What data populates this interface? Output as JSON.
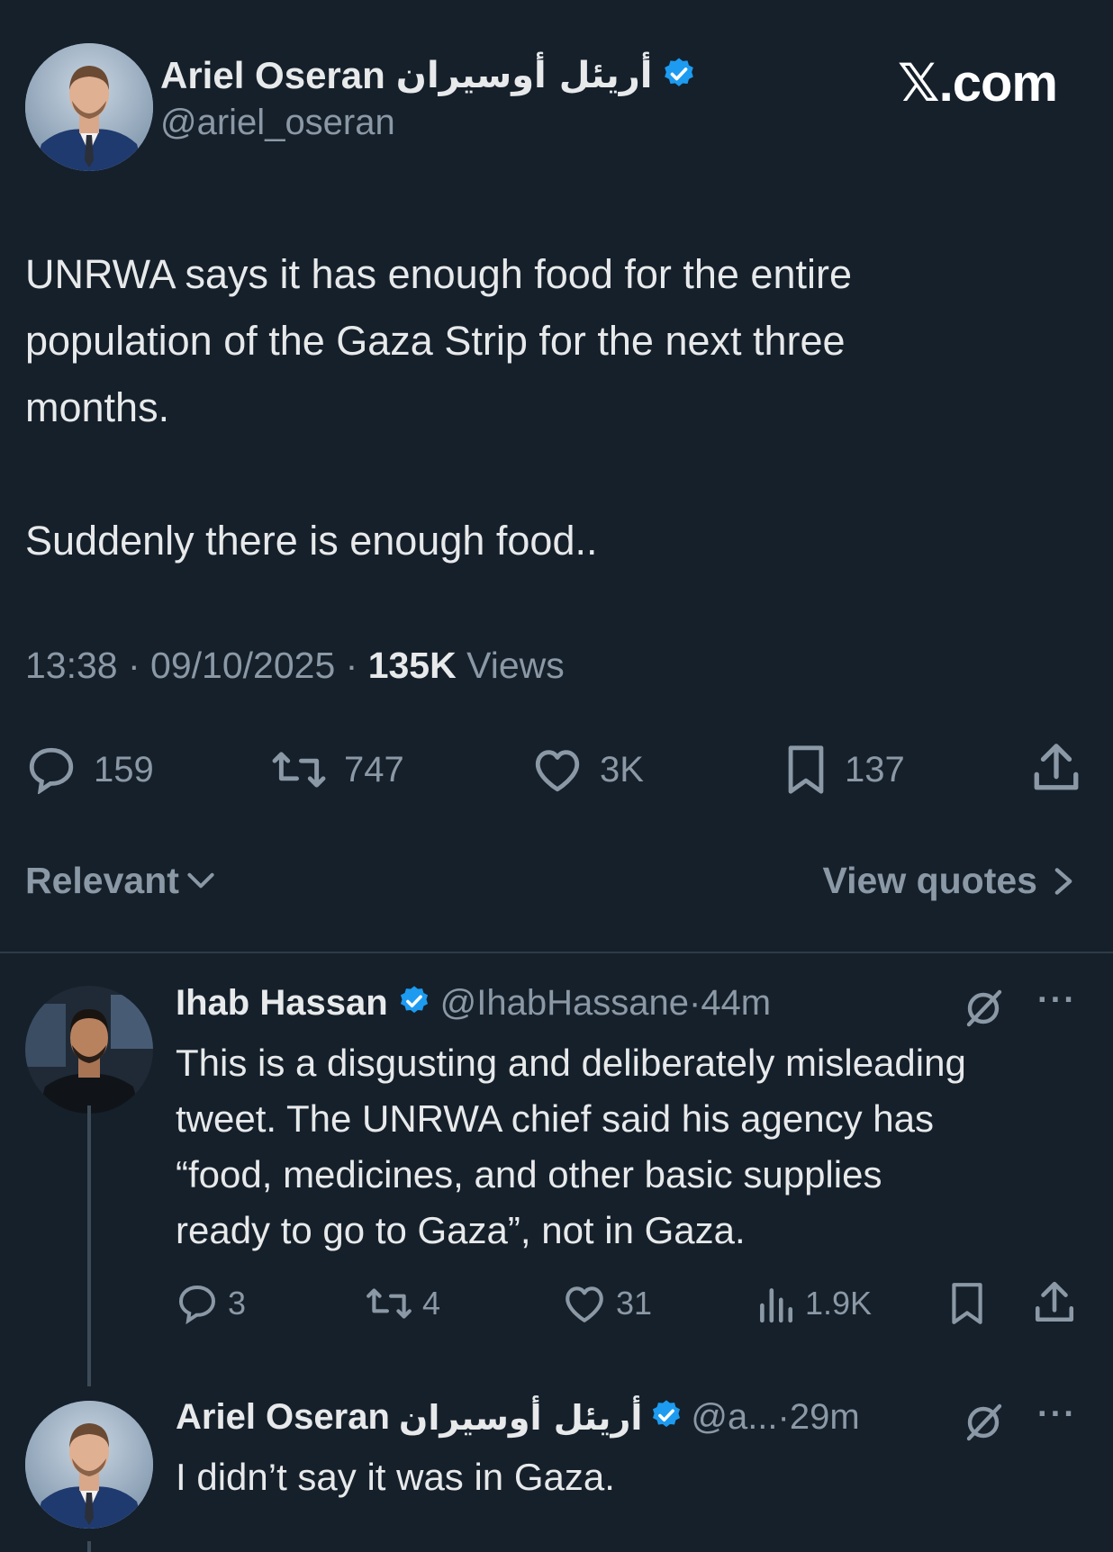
{
  "site_logo": "𝕏.com",
  "main_tweet": {
    "author_name": "Ariel Oseran",
    "author_name_arabic": "أريئل أوسيران",
    "handle": "@ariel_oseran",
    "text_lines": [
      "UNRWA says it has enough food for the entire",
      "population of the Gaza Strip for the next three",
      "months."
    ],
    "text_line_2": "Suddenly there is enough food..",
    "time": "13:38",
    "date": "09/10/2025",
    "views_count": "135K",
    "views_label": "Views",
    "replies": "159",
    "reposts": "747",
    "likes": "3K",
    "bookmarks": "137"
  },
  "sort": {
    "relevant_label": "Relevant",
    "view_quotes_label": "View quotes"
  },
  "replies": [
    {
      "author_name": "Ihab Hassan",
      "handle": "@IhabHassane",
      "time": "44m",
      "text_lines": [
        "This is a disgusting and deliberately misleading",
        "tweet. The UNRWA chief said his agency has",
        "“food, medicines, and other basic supplies",
        "ready to go to Gaza”, not in Gaza."
      ],
      "replies": "3",
      "reposts": "4",
      "likes": "31",
      "views": "1.9K"
    },
    {
      "author_name": "Ariel Oseran",
      "author_name_arabic": "أريئل أوسيران",
      "handle": "@a...",
      "time": "29m",
      "text": "I didn’t say it was in Gaza."
    }
  ],
  "colors": {
    "background": "#15202b",
    "text": "#e7e9ea",
    "muted": "#8b98a5",
    "verified": "#1d9bf0"
  }
}
